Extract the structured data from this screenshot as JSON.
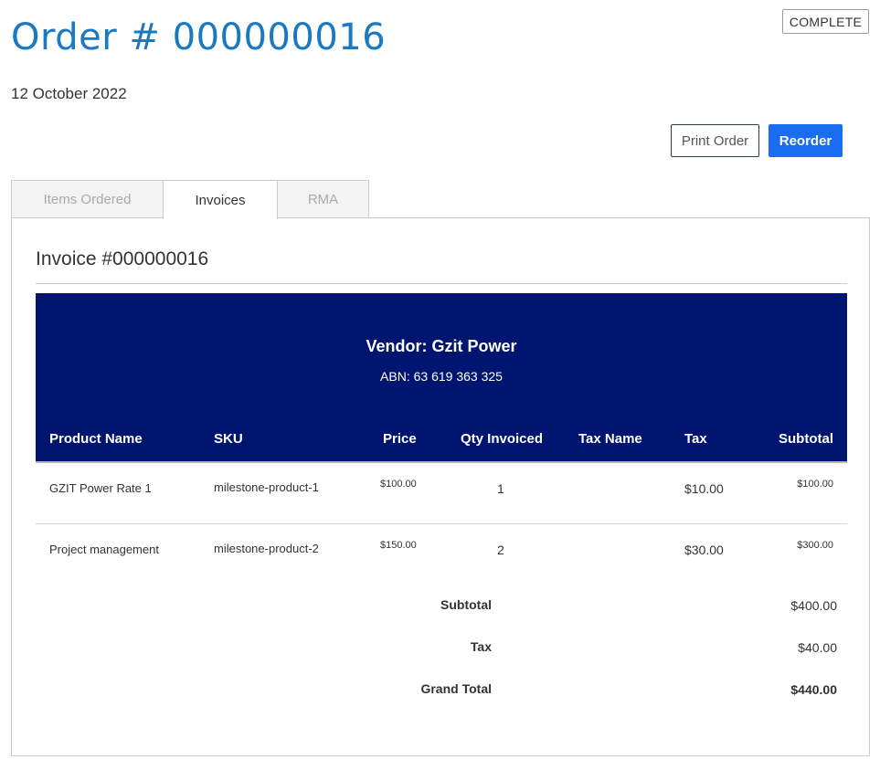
{
  "order": {
    "title": "Order # 000000016",
    "status": "COMPLETE",
    "date": "12 October 2022"
  },
  "actions": {
    "print_label": "Print Order",
    "reorder_label": "Reorder"
  },
  "tabs": [
    {
      "label": "Items Ordered",
      "active": false
    },
    {
      "label": "Invoices",
      "active": true
    },
    {
      "label": "RMA",
      "active": false
    }
  ],
  "invoice": {
    "title": "Invoice #000000016",
    "vendor_name": "Vendor: Gzit Power",
    "abn": "ABN: 63 619 363 325",
    "headers": {
      "product_name": "Product Name",
      "sku": "SKU",
      "price": "Price",
      "qty": "Qty Invoiced",
      "tax_name": "Tax Name",
      "tax": "Tax",
      "subtotal": "Subtotal"
    },
    "rows": [
      {
        "name": "GZIT Power Rate 1",
        "sku": "milestone-product-1",
        "price": "$100.00",
        "qty": "1",
        "tax_name": "",
        "tax": "$10.00",
        "subtotal": "$100.00"
      },
      {
        "name": "Project management",
        "sku": "milestone-product-2",
        "price": "$150.00",
        "qty": "2",
        "tax_name": "",
        "tax": "$30.00",
        "subtotal": "$300.00"
      }
    ],
    "totals": {
      "subtotal_label": "Subtotal",
      "subtotal": "$400.00",
      "tax_label": "Tax",
      "tax": "$40.00",
      "grand_total_label": "Grand Total",
      "grand_total": "$440.00"
    }
  },
  "colors": {
    "title_blue": "#1979c3",
    "button_blue": "#1a6cf0",
    "vendor_navy": "#001570"
  }
}
